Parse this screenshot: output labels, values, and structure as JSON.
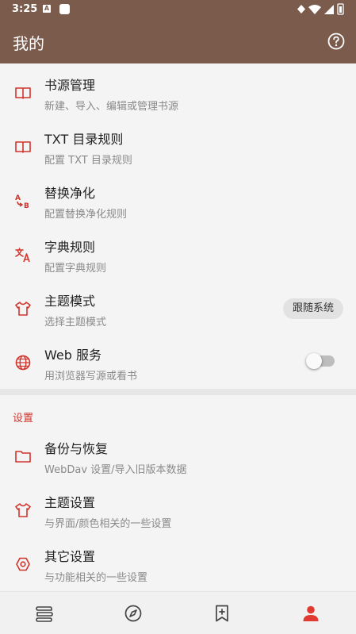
{
  "status_bar": {
    "time": "3:25",
    "notif_letter": "A"
  },
  "toolbar": {
    "title": "我的",
    "help_icon": "help-circle-icon"
  },
  "colors": {
    "accent": "#d0342c",
    "toolbar": "#7a5b4c"
  },
  "items": [
    {
      "title": "书源管理",
      "subtitle": "新建、导入、编辑或管理书源",
      "icon": "book-open-icon"
    },
    {
      "title": "TXT 目录规则",
      "subtitle": "配置 TXT 目录规则",
      "icon": "book-open-icon"
    },
    {
      "title": "替换净化",
      "subtitle": "配置替换净化规则",
      "icon": "replace-ab-icon"
    },
    {
      "title": "字典规则",
      "subtitle": "配置字典规则",
      "icon": "translate-icon"
    },
    {
      "title": "主题模式",
      "subtitle": "选择主题模式",
      "icon": "tshirt-icon",
      "value": "跟随系统"
    },
    {
      "title": "Web 服务",
      "subtitle": "用浏览器写源或看书",
      "icon": "globe-icon",
      "toggle": false
    }
  ],
  "settings_section": {
    "label": "设置",
    "items": [
      {
        "title": "备份与恢复",
        "subtitle": "WebDav 设置/导入旧版本数据",
        "icon": "folder-icon"
      },
      {
        "title": "主题设置",
        "subtitle": "与界面/颜色相关的一些设置",
        "icon": "tshirt-icon"
      },
      {
        "title": "其它设置",
        "subtitle": "与功能相关的一些设置",
        "icon": "hexagon-gear-icon"
      }
    ]
  },
  "bottom_nav": [
    {
      "name": "bookshelf",
      "icon": "bookshelf-icon",
      "active": false
    },
    {
      "name": "explore",
      "icon": "compass-icon",
      "active": false
    },
    {
      "name": "rss",
      "icon": "bookmark-add-icon",
      "active": false
    },
    {
      "name": "my",
      "icon": "person-icon",
      "active": true
    }
  ]
}
